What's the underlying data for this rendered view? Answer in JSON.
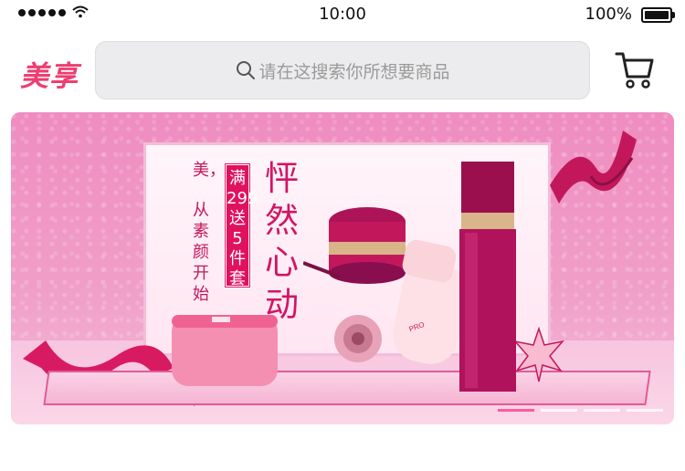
{
  "status_bar": {
    "time": "10:00",
    "battery_percent": "100%",
    "signal_icon": "signal-dots-icon",
    "wifi_icon": "wifi-icon",
    "battery_icon": "battery-icon"
  },
  "header": {
    "logo": "美享",
    "logo_color": "#ee3d6f",
    "search": {
      "icon": "search-icon",
      "placeholder": "请在这搜索你所想要商品"
    },
    "cart_icon": "cart-icon"
  },
  "banner": {
    "slogan_1": "美，",
    "slogan_2": "从素颜开始",
    "promo": "满299送5件套",
    "headline": "怦然心动",
    "carousel": {
      "slides": 4,
      "active_index": 0,
      "active_color": "#ff5aa0"
    }
  }
}
